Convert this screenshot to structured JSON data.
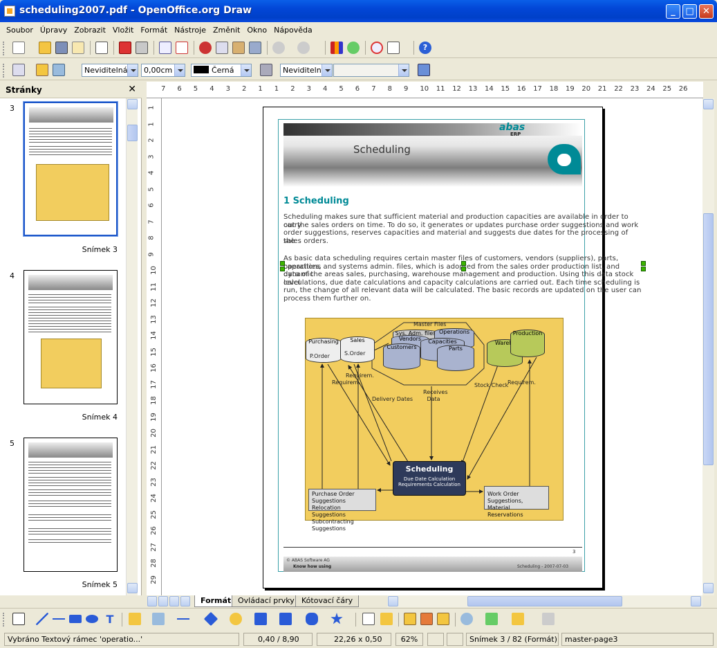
{
  "window": {
    "title": "scheduling2007.pdf - OpenOffice.org Draw"
  },
  "menu": [
    "Soubor",
    "Úpravy",
    "Zobrazit",
    "Vložit",
    "Formát",
    "Nástroje",
    "Změnit",
    "Okno",
    "Nápověda"
  ],
  "line_toolbar": {
    "line_style": "Neviditelná",
    "line_width": "0,00cm",
    "line_color": "Černá",
    "area_style": "Neviditelná",
    "area_fill": ""
  },
  "pages_panel": {
    "title": "Stránky",
    "pages": [
      {
        "number": "3",
        "caption": "Snímek 3"
      },
      {
        "number": "4",
        "caption": "Snímek 4"
      },
      {
        "number": "5",
        "caption": "Snímek 5"
      }
    ]
  },
  "hruler": [
    "7",
    "6",
    "5",
    "4",
    "3",
    "2",
    "1",
    "1",
    "2",
    "3",
    "4",
    "5",
    "6",
    "7",
    "8",
    "9",
    "10",
    "11",
    "12",
    "13",
    "14",
    "15",
    "16",
    "17",
    "18",
    "19",
    "20",
    "21",
    "22",
    "23",
    "24",
    "25",
    "26"
  ],
  "vruler": [
    "1",
    "1",
    "2",
    "3",
    "4",
    "5",
    "6",
    "7",
    "8",
    "9",
    "10",
    "11",
    "12",
    "13",
    "14",
    "15",
    "16",
    "17",
    "18",
    "19",
    "20",
    "21",
    "22",
    "23",
    "24",
    "25",
    "26",
    "27",
    "28",
    "29"
  ],
  "tabs": [
    "Formát",
    "Ovládací prvky",
    "Kótovací čáry"
  ],
  "status": {
    "selection": "Vybráno Textový rámec 'operatio...'",
    "position": "0,40 / 8,90",
    "size": "22,26 x 0,50",
    "zoom": "62%",
    "page": "Snímek 3 / 82 (Formát)",
    "master": "master-page3"
  },
  "document": {
    "logo": "abas",
    "logo_sub": "ERP",
    "header_title": "Scheduling",
    "heading": "1 Scheduling",
    "para1": [
      "Scheduling makes sure that sufficient material and production capacities are available in order to carry",
      "out the sales orders on time. To do so, it generates or updates purchase order suggestions and work",
      "order suggestions, reserves capacities and material and suggests due dates for the processing of the",
      "sales orders."
    ],
    "para2": [
      "As basic data scheduling requires certain master files of customers, vendors (suppliers), parts, capacities,",
      "operations and systems admin. files, which is adopted from the sales order production list, and dynamic",
      "data of the areas sales, purchasing, warehouse management and production. Using this data stock level",
      "calculations, due date calculations and capacity calculations are carried out. Each time scheduling is",
      "run, the change of all relevant data will be calculated. The basic records are updated on the user can",
      "process them further on."
    ],
    "diagram": {
      "master_files": "Master Files",
      "sys_adm": "Sys. Adm. files",
      "operations": "Operations",
      "vendors": "Vendors",
      "capacities": "Capacities",
      "customers": "Customers",
      "parts": "Parts",
      "purchasing": "Purchasing",
      "sales": "Sales",
      "porder": "P.Order",
      "sorder": "S.Order",
      "wareh": "Wareh.",
      "production": "Production",
      "requirem1": "Requirem.",
      "requirem2": "Requirem.",
      "requirem3": "Requirem.",
      "delivery_dates": "Delivery Dates",
      "receives_data": "Receives Data",
      "stock_check": "Stock Check",
      "center_title": "Scheduling",
      "center_l1": "Due Date Calculation",
      "center_l2": "Requirements Calculation",
      "left_box": [
        "Purchase Order Suggestions",
        "Relocation Suggestions",
        "Subcontracting Suggestions"
      ],
      "right_box": [
        "Work Order Suggestions,",
        "Material Reservations"
      ]
    },
    "footer_page": "3",
    "footer_company": "© ABAS Software AG",
    "footer_slogan": "Know how using",
    "footer_right": "Scheduling - 2007-07-03"
  }
}
